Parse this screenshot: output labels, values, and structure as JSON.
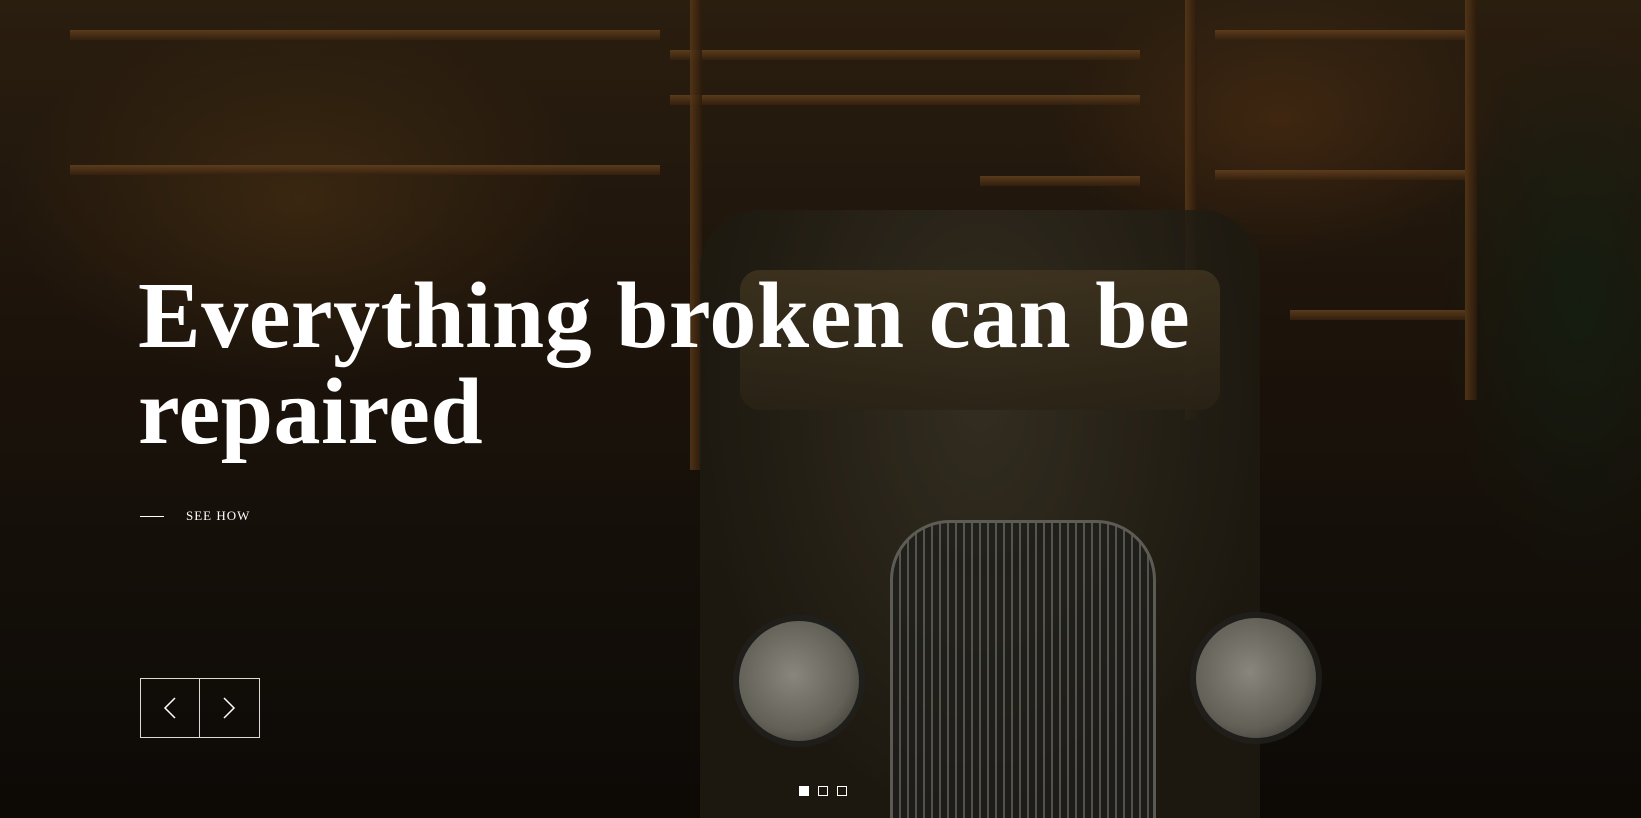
{
  "hero": {
    "headline_line1": "Everything broken can be",
    "headline_line2": "repaired",
    "cta_label": "SEE HOW",
    "background_icon": "vintage-garage-car-photo"
  },
  "slider": {
    "prev_icon": "chevron-left-icon",
    "next_icon": "chevron-right-icon",
    "dots": [
      {
        "active": true
      },
      {
        "active": false
      },
      {
        "active": false
      }
    ],
    "active_index": 0
  },
  "colors": {
    "text": "#ffffff",
    "overlay": "#000000"
  }
}
